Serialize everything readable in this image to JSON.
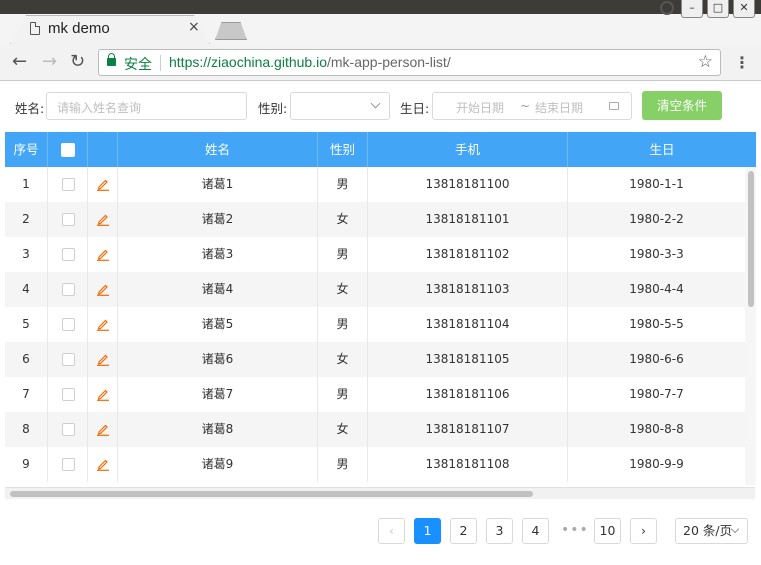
{
  "browser": {
    "tab_title": "mk demo",
    "tab_close": "×",
    "secure_label": "安全",
    "url_host": "https://ziaochina.github.io",
    "url_path": "/mk-app-person-list/"
  },
  "filter": {
    "name_label": "姓名:",
    "name_placeholder": "请输入姓名查询",
    "gender_label": "性别:",
    "birthday_label": "生日:",
    "start_placeholder": "开始日期",
    "range_sep": "~",
    "end_placeholder": "结束日期",
    "clear_label": "清空条件"
  },
  "table": {
    "headers": {
      "index": "序号",
      "name": "姓名",
      "gender": "性别",
      "mobile": "手机",
      "birthday": "生日"
    },
    "rows": [
      {
        "index": "1",
        "name": "诸葛1",
        "gender": "男",
        "mobile": "13818181100",
        "birthday": "1980-1-1"
      },
      {
        "index": "2",
        "name": "诸葛2",
        "gender": "女",
        "mobile": "13818181101",
        "birthday": "1980-2-2"
      },
      {
        "index": "3",
        "name": "诸葛3",
        "gender": "男",
        "mobile": "13818181102",
        "birthday": "1980-3-3"
      },
      {
        "index": "4",
        "name": "诸葛4",
        "gender": "女",
        "mobile": "13818181103",
        "birthday": "1980-4-4"
      },
      {
        "index": "5",
        "name": "诸葛5",
        "gender": "男",
        "mobile": "13818181104",
        "birthday": "1980-5-5"
      },
      {
        "index": "6",
        "name": "诸葛6",
        "gender": "女",
        "mobile": "13818181105",
        "birthday": "1980-6-6"
      },
      {
        "index": "7",
        "name": "诸葛7",
        "gender": "男",
        "mobile": "13818181106",
        "birthday": "1980-7-7"
      },
      {
        "index": "8",
        "name": "诸葛8",
        "gender": "女",
        "mobile": "13818181107",
        "birthday": "1980-8-8"
      },
      {
        "index": "9",
        "name": "诸葛9",
        "gender": "男",
        "mobile": "13818181108",
        "birthday": "1980-9-9"
      }
    ]
  },
  "pagination": {
    "prev": "‹",
    "pages": [
      "1",
      "2",
      "3",
      "4"
    ],
    "ellipsis": "•••",
    "last_page": "10",
    "next": "›",
    "current": "1",
    "page_size": "20 条/页"
  },
  "colors": {
    "header_bg": "#42a5f5",
    "clear_button": "#87d068",
    "active_page": "#1890ff",
    "edit_icon": "#f56a00"
  }
}
